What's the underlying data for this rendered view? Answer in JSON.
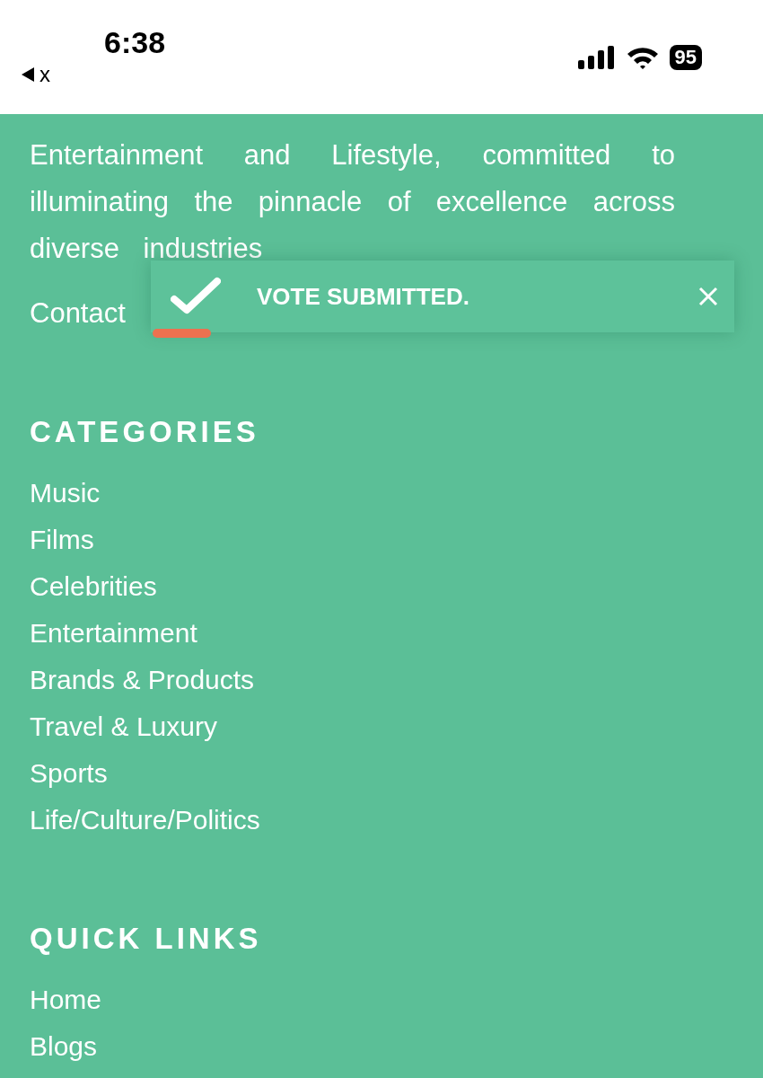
{
  "status_bar": {
    "time": "6:38",
    "back_app": "x",
    "battery": "95"
  },
  "about": {
    "text": "Entertainment and Lifestyle, committed to illuminating the pinnacle of excellence across diverse industries",
    "contact": "Contact"
  },
  "toast": {
    "message": "VOTE SUBMITTED.",
    "level": 0.1
  },
  "sections": [
    {
      "title": "CATEGORIES",
      "links": [
        "Music",
        "Films",
        "Celebrities",
        "Entertainment",
        "Brands & Products",
        "Travel & Luxury",
        "Sports",
        "Life/Culture/Politics"
      ]
    },
    {
      "title": "QUICK LINKS",
      "links": [
        "Home",
        "Blogs"
      ]
    }
  ]
}
